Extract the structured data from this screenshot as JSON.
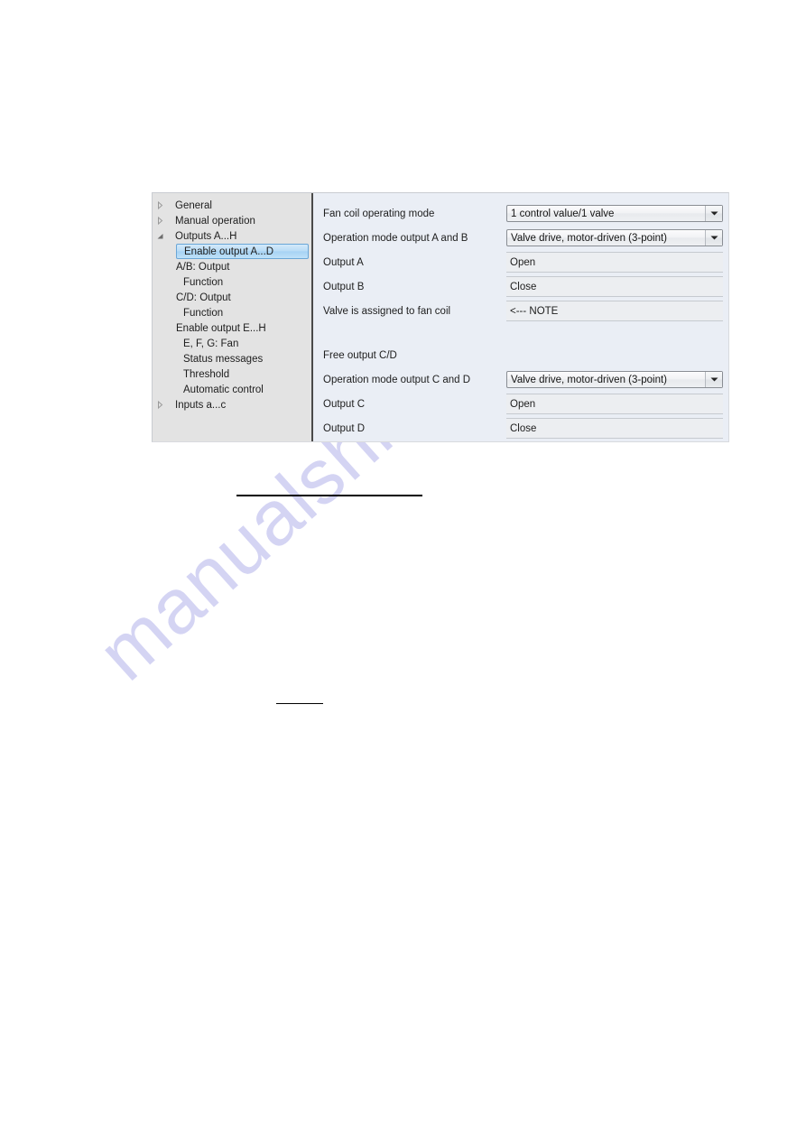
{
  "watermark": {
    "text": "manualshive.com"
  },
  "tree": {
    "items": [
      {
        "label": "General",
        "twisty": "collapsed-triangle-icon",
        "indent": 0,
        "selected": false
      },
      {
        "label": "Manual operation",
        "twisty": "collapsed-triangle-icon",
        "indent": 0,
        "selected": false
      },
      {
        "label": "Outputs A...H",
        "twisty": "expanded-triangle-icon",
        "indent": 0,
        "selected": false
      },
      {
        "label": "Enable output A...D",
        "twisty": "none",
        "indent": 1,
        "selected": true
      },
      {
        "label": "A/B: Output",
        "twisty": "none",
        "indent": 2,
        "selected": false
      },
      {
        "label": "Function",
        "twisty": "none",
        "indent": 3,
        "selected": false
      },
      {
        "label": "C/D: Output",
        "twisty": "none",
        "indent": 2,
        "selected": false
      },
      {
        "label": "Function",
        "twisty": "none",
        "indent": 3,
        "selected": false
      },
      {
        "label": "Enable output E...H",
        "twisty": "none",
        "indent": 1,
        "selected": false
      },
      {
        "label": "E, F, G: Fan",
        "twisty": "none",
        "indent": 2,
        "selected": false
      },
      {
        "label": "Status messages",
        "twisty": "none",
        "indent": 3,
        "selected": false
      },
      {
        "label": "Threshold",
        "twisty": "none",
        "indent": 3,
        "selected": false
      },
      {
        "label": "Automatic control",
        "twisty": "none",
        "indent": 3,
        "selected": false
      },
      {
        "label": "Inputs a...c",
        "twisty": "collapsed-triangle-icon",
        "indent": 0,
        "selected": false
      }
    ]
  },
  "params": {
    "fan_coil_operating_mode": {
      "label": "Fan coil operating mode",
      "value": "1 control value/1 valve"
    },
    "operation_mode_ab": {
      "label": "Operation mode output A and B",
      "value": "Valve drive, motor-driven (3-point)"
    },
    "output_a": {
      "label": "Output A",
      "value": "Open"
    },
    "output_b": {
      "label": "Output B",
      "value": "Close"
    },
    "valve_assigned": {
      "label": "Valve is assigned to fan coil",
      "value": "<--- NOTE"
    },
    "free_output_cd": {
      "label": "Free output C/D"
    },
    "operation_mode_cd": {
      "label": "Operation mode output C and D",
      "value": "Valve drive, motor-driven (3-point)"
    },
    "output_c": {
      "label": "Output C",
      "value": "Open"
    },
    "output_d": {
      "label": "Output D",
      "value": "Close"
    }
  },
  "colors": {
    "tree_background": "#e3e3e3",
    "param_background": "#eaeef5",
    "selection_blue": "#a6d2f4",
    "watermark_purple": "#cdcdf2"
  }
}
